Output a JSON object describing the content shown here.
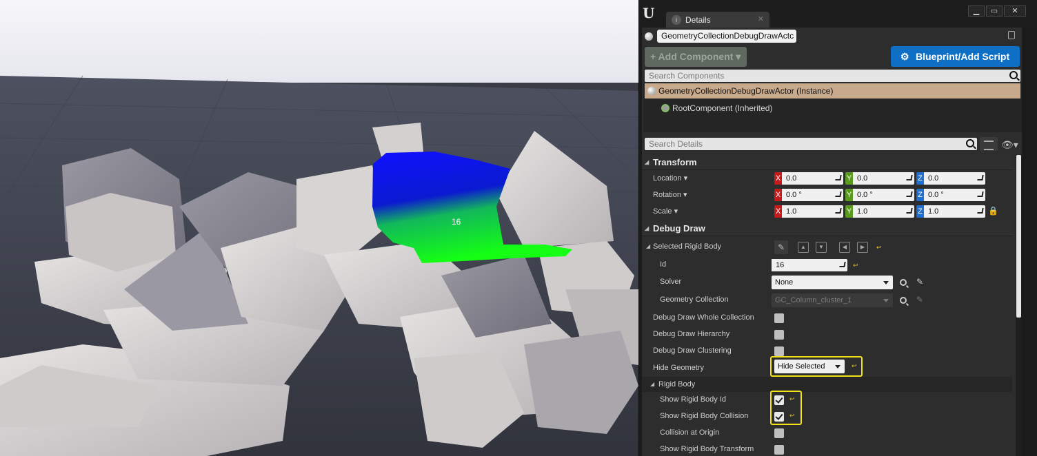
{
  "viewport": {
    "overlay_label": "16"
  },
  "panel": {
    "tab_label": "Details",
    "tab_icon": "info-icon",
    "actor_name": "GeometryCollectionDebugDrawActc",
    "add_component_label": "+ Add Component ▾",
    "blueprint_label": "Blueprint/Add Script",
    "search_components_placeholder": "Search Components",
    "search_details_placeholder": "Search Details",
    "components": [
      {
        "label": "GeometryCollectionDebugDrawActor (Instance)"
      },
      {
        "label": "RootComponent (Inherited)"
      }
    ],
    "colors": {
      "accent_blue": "#0f6fc4",
      "selection": "#c8a98b",
      "highlight": "#f2e41c"
    }
  },
  "transform": {
    "title": "Transform",
    "location": {
      "label": "Location ▾",
      "x": "0.0",
      "y": "0.0",
      "z": "0.0"
    },
    "rotation": {
      "label": "Rotation ▾",
      "x": "0.0 °",
      "y": "0.0 °",
      "z": "0.0 °"
    },
    "scale": {
      "label": "Scale ▾",
      "x": "1.0",
      "y": "1.0",
      "z": "1.0"
    },
    "axis_labels": {
      "x": "X",
      "y": "Y",
      "z": "Z"
    }
  },
  "debug_draw": {
    "title": "Debug Draw",
    "selected_rigid_body": "Selected Rigid Body",
    "id_label": "Id",
    "id_value": "16",
    "solver_label": "Solver",
    "solver_value": "None",
    "geometry_collection_label": "Geometry Collection",
    "geometry_collection_value": "GC_Column_cluster_1",
    "whole_collection_label": "Debug Draw Whole Collection",
    "hierarchy_label": "Debug Draw Hierarchy",
    "clustering_label": "Debug Draw Clustering",
    "hide_geometry_label": "Hide Geometry",
    "hide_geometry_value": "Hide Selected",
    "rigid_body_sub": "Rigid Body",
    "show_id_label": "Show Rigid Body Id",
    "show_collision_label": "Show Rigid Body Collision",
    "collision_origin_label": "Collision at Origin",
    "show_transform_label": "Show Rigid Body Transform"
  }
}
